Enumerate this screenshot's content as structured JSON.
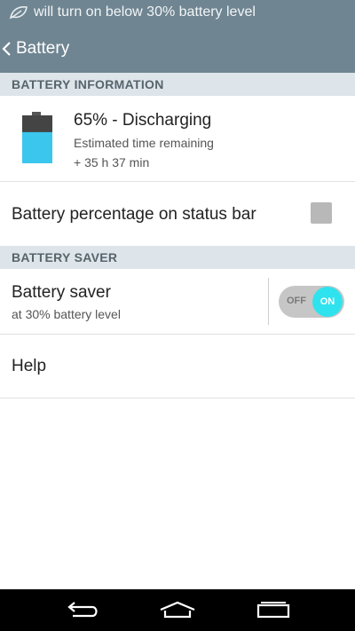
{
  "status_bar": {
    "notice": "will turn on below 30% battery level",
    "icon": "leaf-icon"
  },
  "action_bar": {
    "back_icon": "chevron-left-icon",
    "title": "Battery"
  },
  "sections": {
    "battery_information": "BATTERY INFORMATION",
    "battery_saver": "BATTERY SAVER"
  },
  "battery_info": {
    "level_percent": 65,
    "status": "65% - Discharging",
    "estimate_label": "Estimated time remaining",
    "estimate_value": "+ 35 h 37 min",
    "icon": "battery-icon",
    "fill_color": "#3bc6ee"
  },
  "percentage_on_status_bar": {
    "label": "Battery percentage on status bar",
    "checked": false
  },
  "battery_saver": {
    "label": "Battery saver",
    "sub": "at 30% battery level",
    "toggle_off": "OFF",
    "toggle_on": "ON",
    "enabled": true,
    "accent": "#2fe3ee"
  },
  "help": {
    "label": "Help"
  },
  "nav": {
    "back_icon": "back-icon",
    "home_icon": "home-icon",
    "recents_icon": "recents-icon"
  }
}
